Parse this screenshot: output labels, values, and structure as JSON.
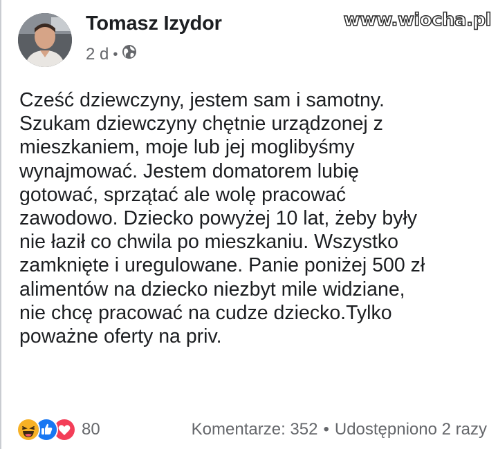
{
  "post": {
    "author": "Tomasz Izydor",
    "time": "2 d",
    "separator": "•",
    "audience_icon": "globe-icon",
    "text_lines": [
      "Cześć dziewczyny, jestem sam i samotny.",
      "Szukam dziewczyny chętnie urządzonej z",
      "mieszkaniem, moje lub jej moglibyśmy",
      "wynajmować. Jestem domatorem lubię",
      "gotować, sprzątać ale wolę pracować",
      "zawodowo. Dziecko powyżej 10 lat, żeby były",
      "nie łaził co chwila po mieszkaniu. Wszystko",
      "zamknięte i uregulowane. Panie poniżej 500 zł",
      "alimentów na dziecko niezbyt mile widziane,",
      "nie chcę pracować na cudze dziecko.Tylko",
      "poważne oferty na priv."
    ]
  },
  "footer": {
    "reaction_icons": [
      "haha-icon",
      "like-icon",
      "love-icon"
    ],
    "reaction_count": "80",
    "comments": "Komentarze: 352",
    "stats_separator": "•",
    "shares": "Udostępniono 2 razy"
  },
  "watermark": "www.wiocha.pl",
  "colors": {
    "text": "#1c1e21",
    "secondary": "#65676b",
    "like": "#1877f2",
    "love": "#f33e58",
    "haha": "#f7b125"
  }
}
